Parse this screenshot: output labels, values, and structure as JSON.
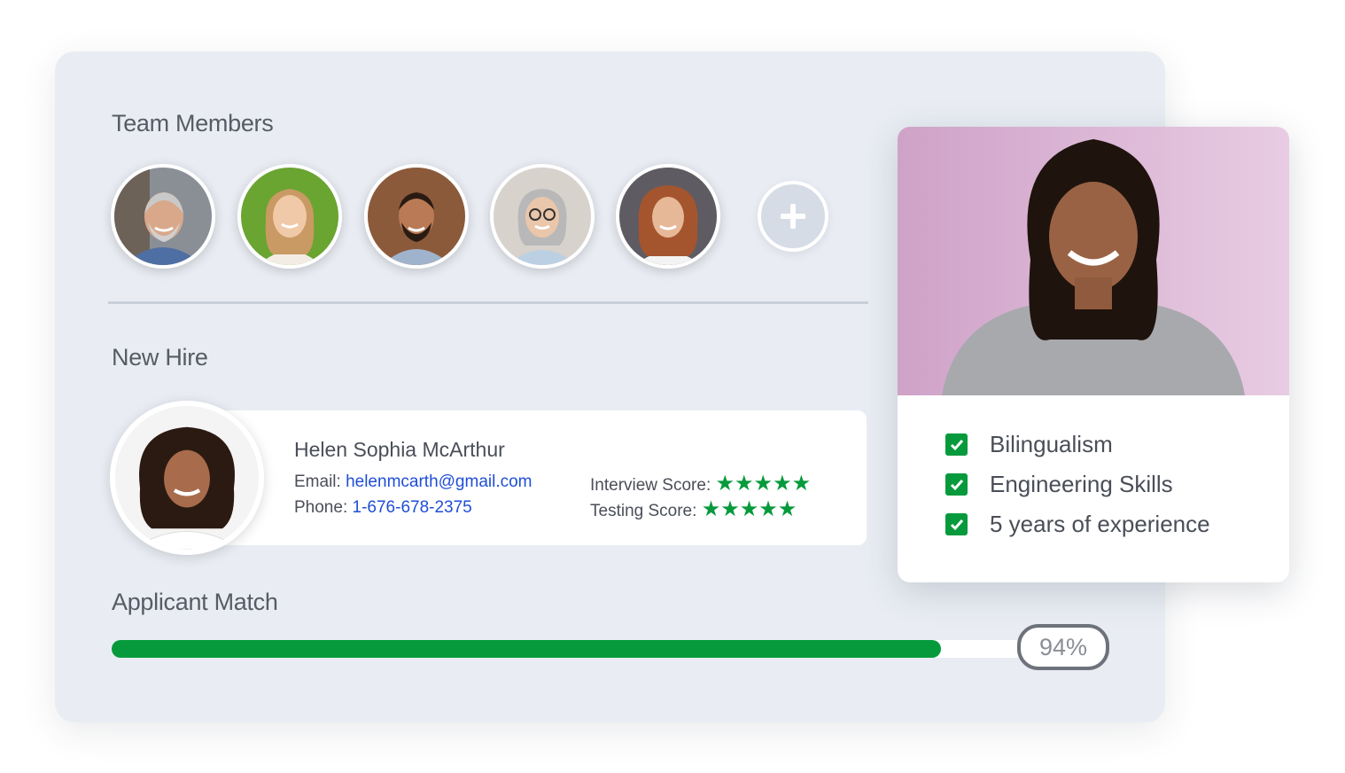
{
  "team": {
    "title": "Team Members",
    "members": [
      {
        "icon": "avatar-man-gray-beard"
      },
      {
        "icon": "avatar-woman-blonde"
      },
      {
        "icon": "avatar-man-headset"
      },
      {
        "icon": "avatar-woman-gray-glasses"
      },
      {
        "icon": "avatar-woman-curly"
      }
    ],
    "add_icon": "plus-icon"
  },
  "new_hire": {
    "title": "New Hire",
    "name": "Helen Sophia McArthur",
    "email_label": "Email:",
    "email": "helenmcarth@gmail.com",
    "phone_label": "Phone:",
    "phone": "1-676-678-2375",
    "interview_label": "Interview Score:",
    "interview_stars": "★★★★★",
    "interview_score": 5,
    "testing_label": "Testing Score:",
    "testing_stars": "★★★★★",
    "testing_score": 5
  },
  "match": {
    "title": "Applicant Match",
    "percent_label": "94%",
    "percent": 94
  },
  "qualifications": [
    {
      "label": "Bilingualism"
    },
    {
      "label": "Engineering Skills"
    },
    {
      "label": "5 years of experience"
    }
  ],
  "colors": {
    "accent": "#079a3c",
    "link": "#1f4ed6",
    "panel": "#e9edf3"
  }
}
